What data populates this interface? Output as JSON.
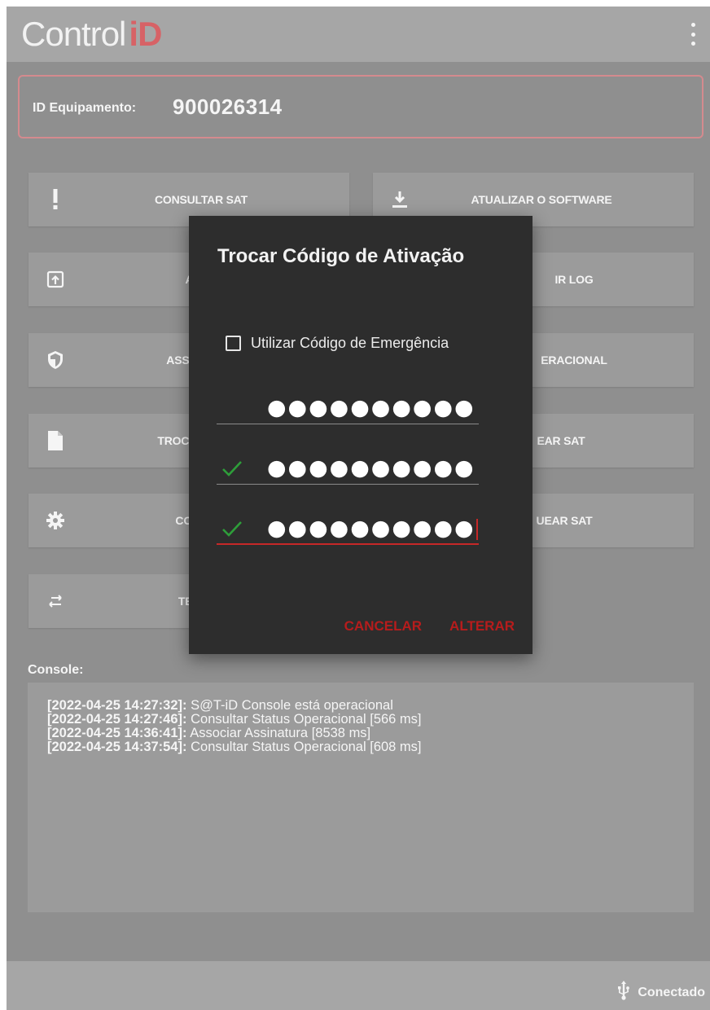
{
  "app": {
    "logo_text": "Control",
    "logo_accent": "iD",
    "accent_color": "#e0575b",
    "menu_icon": "more-vert-icon"
  },
  "device": {
    "label": "ID Equipamento:",
    "value": "900026314"
  },
  "buttons": {
    "consultar_sat": {
      "label": "CONSULTAR SAT",
      "icon": "exclamation-icon"
    },
    "atualizar_software": {
      "label": "ATUALIZAR O SOFTWARE",
      "icon": "download-icon"
    },
    "ativar": {
      "label": "ATIVA",
      "icon": "upload-box-icon"
    },
    "extrair_log": {
      "label": "IR LOG",
      "icon": ""
    },
    "associar": {
      "label": "ASSOCIAR A",
      "icon": "shield-icon"
    },
    "status_operacional": {
      "label": "ERACIONAL",
      "icon": ""
    },
    "trocar_codigo": {
      "label": "TROCAR CÓDIG",
      "icon": "file-icon"
    },
    "bloquear_sat": {
      "label": "EAR SAT",
      "icon": ""
    },
    "configurar": {
      "label": "CONFIGU",
      "icon": "gear-icon"
    },
    "desbloquear_sat": {
      "label": "UEAR SAT",
      "icon": ""
    },
    "teste_fim": {
      "label": "TESTE F",
      "icon": "swap-icon"
    }
  },
  "console": {
    "label": "Console:",
    "lines": [
      {
        "ts": "[2022-04-25 14:27:32]:",
        "msg": " S@T-iD Console está operacional"
      },
      {
        "ts": "[2022-04-25 14:27:46]:",
        "msg": " Consultar Status Operacional [566 ms]"
      },
      {
        "ts": "[2022-04-25 14:36:41]:",
        "msg": " Associar Assinatura [8538 ms]"
      },
      {
        "ts": "[2022-04-25 14:37:54]:",
        "msg": " Consultar Status Operacional [608 ms]"
      }
    ]
  },
  "footer": {
    "status": "Conectado",
    "status_icon": "usb-icon"
  },
  "dialog": {
    "title": "Trocar Código de Ativação",
    "checkbox_label": "Utilizar Código de Emergência",
    "checkbox_checked": false,
    "fields": [
      {
        "value": "●●●●●●●●●●",
        "valid": false
      },
      {
        "value": "●●●●●●●●●●",
        "valid": true
      },
      {
        "value": "●●●●●●●●●●",
        "valid": true,
        "focused": true
      }
    ],
    "valid_color": "#2e9e3a",
    "cancel_label": "CANCELAR",
    "confirm_label": "ALTERAR",
    "action_color": "#b71c1c"
  }
}
